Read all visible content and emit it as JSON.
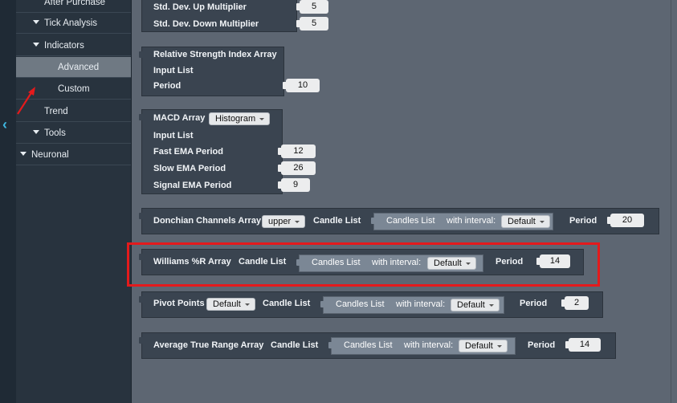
{
  "sidebar": {
    "items": [
      {
        "label": "After Purchase"
      },
      {
        "label": "Tick Analysis"
      },
      {
        "label": "Indicators"
      },
      {
        "label": "Advanced"
      },
      {
        "label": "Custom"
      },
      {
        "label": "Trend"
      },
      {
        "label": "Tools"
      },
      {
        "label": "Neuronal"
      }
    ]
  },
  "blocks": {
    "stddev": {
      "up_label": "Std. Dev. Up Multiplier",
      "up_value": "5",
      "down_label": "Std. Dev. Down Multiplier",
      "down_value": "5"
    },
    "rsi": {
      "title": "Relative Strength Index Array",
      "input_label": "Input List",
      "period_label": "Period",
      "period_value": "10"
    },
    "macd": {
      "title": "MACD Array",
      "mode": "Histogram",
      "input_label": "Input List",
      "fast_label": "Fast EMA Period",
      "fast_value": "12",
      "slow_label": "Slow EMA Period",
      "slow_value": "26",
      "signal_label": "Signal EMA Period",
      "signal_value": "9"
    },
    "donchian": {
      "title": "Donchian Channels  Array",
      "band": "upper",
      "candle_label": "Candle List",
      "candles": "Candles List",
      "interval_label": "with interval:",
      "interval": "Default",
      "period_label": "Period",
      "period_value": "20"
    },
    "williams": {
      "title": "Williams %R Array",
      "candle_label": "Candle List",
      "candles": "Candles List",
      "interval_label": "with interval:",
      "interval": "Default",
      "period_label": "Period",
      "period_value": "14"
    },
    "pivot": {
      "title": "Pivot Points",
      "mode": "Default",
      "candle_label": "Candle List",
      "candles": "Candles List",
      "interval_label": "with interval:",
      "interval": "Default",
      "period_label": "Period",
      "period_value": "2"
    },
    "atr": {
      "title": "Average True Range Array",
      "candle_label": "Candle List",
      "candles": "Candles List",
      "interval_label": "with interval:",
      "interval": "Default",
      "period_label": "Period",
      "period_value": "14"
    }
  },
  "colors": {
    "highlight": "#e41a1c",
    "accent": "#3fb7e0"
  },
  "icons": {
    "collapse": "chevron-left-icon",
    "annotation": "red-arrow-icon"
  }
}
